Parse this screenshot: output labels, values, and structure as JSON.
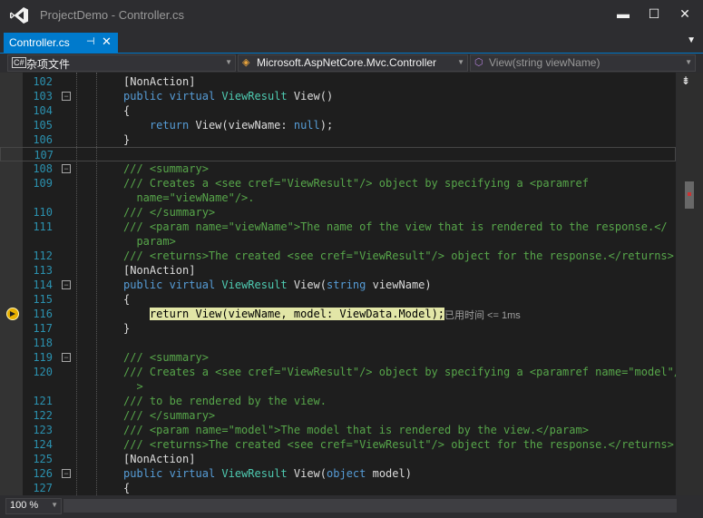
{
  "window": {
    "title": "ProjectDemo - Controller.cs",
    "minimize": "▬",
    "maximize": "☐",
    "close": "✕"
  },
  "tab": {
    "label": "Controller.cs",
    "pin": "⊣",
    "close": "✕",
    "overflow": "▼"
  },
  "nav": {
    "project": "杂项文件",
    "class": "Microsoft.AspNetCore.Mvc.Controller",
    "member": "View(string viewName)"
  },
  "current_line": 116,
  "elapsed_text": "已用时间 <= 1ms",
  "lines": [
    {
      "n": "102",
      "t": "[NonAction]"
    },
    {
      "n": "103",
      "t": "public virtual ViewResult View()"
    },
    {
      "n": "104",
      "t": "{"
    },
    {
      "n": "105",
      "t": "    return View(viewName: null);"
    },
    {
      "n": "106",
      "t": "}"
    },
    {
      "n": "107",
      "t": ""
    },
    {
      "n": "108",
      "t": "/// <summary>"
    },
    {
      "n": "109",
      "t": "/// Creates a <see cref=\"ViewResult\"/> object by specifying a <paramref"
    },
    {
      "n": "",
      "t": "  name=\"viewName\"/>."
    },
    {
      "n": "110",
      "t": "/// </summary>"
    },
    {
      "n": "111",
      "t": "/// <param name=\"viewName\">The name of the view that is rendered to the response.</"
    },
    {
      "n": "",
      "t": "  param>"
    },
    {
      "n": "112",
      "t": "/// <returns>The created <see cref=\"ViewResult\"/> object for the response.</returns>"
    },
    {
      "n": "113",
      "t": "[NonAction]"
    },
    {
      "n": "114",
      "t": "public virtual ViewResult View(string viewName)"
    },
    {
      "n": "115",
      "t": "{"
    },
    {
      "n": "116",
      "t": "    return View(viewName, model: ViewData.Model);"
    },
    {
      "n": "117",
      "t": "}"
    },
    {
      "n": "118",
      "t": ""
    },
    {
      "n": "119",
      "t": "/// <summary>"
    },
    {
      "n": "120",
      "t": "/// Creates a <see cref=\"ViewResult\"/> object by specifying a <paramref name=\"model\"/"
    },
    {
      "n": "",
      "t": "  >"
    },
    {
      "n": "121",
      "t": "/// to be rendered by the view."
    },
    {
      "n": "122",
      "t": "/// </summary>"
    },
    {
      "n": "123",
      "t": "/// <param name=\"model\">The model that is rendered by the view.</param>"
    },
    {
      "n": "124",
      "t": "/// <returns>The created <see cref=\"ViewResult\"/> object for the response.</returns>"
    },
    {
      "n": "125",
      "t": "[NonAction]"
    },
    {
      "n": "126",
      "t": "public virtual ViewResult View(object model)"
    },
    {
      "n": "127",
      "t": "{"
    }
  ],
  "zoom": "100 %",
  "colors": {
    "accent": "#007acc",
    "editor_bg": "#1e1e1e",
    "keyword": "#569cd6",
    "comment": "#57a64a",
    "line_number": "#2b91af",
    "highlight": "#e2e6a7"
  }
}
